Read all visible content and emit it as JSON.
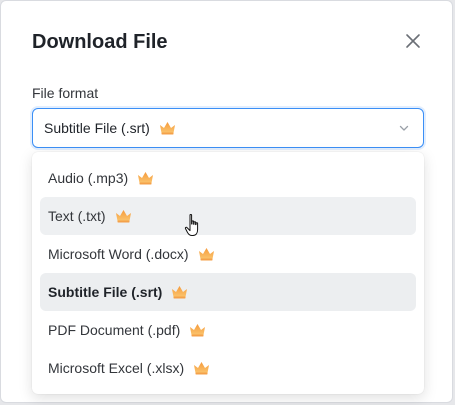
{
  "dialog": {
    "title": "Download File",
    "close_icon": "close-icon"
  },
  "form": {
    "label": "File format",
    "selected_value": "Subtitle File (.srt)",
    "premium_icon": "crown-icon",
    "dropdown_icon": "chevron-down-icon"
  },
  "options": [
    {
      "label": "Audio (.mp3)",
      "premium": true,
      "state": "normal"
    },
    {
      "label": "Text (.txt)",
      "premium": true,
      "state": "hover"
    },
    {
      "label": "Microsoft Word (.docx)",
      "premium": true,
      "state": "normal"
    },
    {
      "label": "Subtitle File (.srt)",
      "premium": true,
      "state": "selected"
    },
    {
      "label": "PDF Document (.pdf)",
      "premium": true,
      "state": "normal"
    },
    {
      "label": "Microsoft Excel (.xlsx)",
      "premium": true,
      "state": "normal"
    }
  ],
  "colors": {
    "accent_border": "#3b8ff6",
    "crown_top": "#f7a84b",
    "crown_bottom": "#f9c46b",
    "hover_bg": "#eef0f2"
  }
}
